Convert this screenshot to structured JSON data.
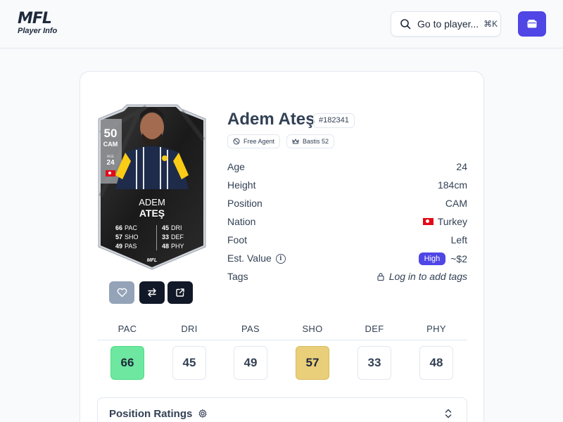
{
  "header": {
    "logo_mark": "MFL",
    "logo_sub": "Player Info",
    "search_label": "Go to player...",
    "search_shortcut": "⌘K"
  },
  "card_graphic": {
    "rating": "50",
    "position": "CAM",
    "age_label": "AGE",
    "age": "24",
    "first_name": "ADEM",
    "last_name": "ATEŞ",
    "stats_left": [
      {
        "value": "66",
        "label": "PAC"
      },
      {
        "value": "57",
        "label": "SHO"
      },
      {
        "value": "49",
        "label": "PAS"
      }
    ],
    "stats_right": [
      {
        "value": "45",
        "label": "DRI"
      },
      {
        "value": "33",
        "label": "DEF"
      },
      {
        "value": "48",
        "label": "PHY"
      }
    ],
    "footer_logo": "MFL"
  },
  "player": {
    "name": "Adem Ateş",
    "id": "#182341",
    "badges": {
      "agent": "Free Agent",
      "club": "Bastis 52"
    }
  },
  "info": {
    "age": {
      "label": "Age",
      "value": "24"
    },
    "height": {
      "label": "Height",
      "value": "184cm"
    },
    "position": {
      "label": "Position",
      "value": "CAM"
    },
    "nation": {
      "label": "Nation",
      "value": "Turkey"
    },
    "foot": {
      "label": "Foot",
      "value": "Left"
    },
    "value": {
      "label": "Est. Value",
      "pill": "High",
      "value": "~$2"
    },
    "tags": {
      "label": "Tags",
      "value": "Log in to add tags"
    }
  },
  "stats": [
    {
      "label": "PAC",
      "value": "66",
      "highlight": "green"
    },
    {
      "label": "DRI",
      "value": "45",
      "highlight": "none"
    },
    {
      "label": "PAS",
      "value": "49",
      "highlight": "none"
    },
    {
      "label": "SHO",
      "value": "57",
      "highlight": "yellow"
    },
    {
      "label": "DEF",
      "value": "33",
      "highlight": "none"
    },
    {
      "label": "PHY",
      "value": "48",
      "highlight": "none"
    }
  ],
  "position_ratings": {
    "title": "Position Ratings"
  },
  "colors": {
    "accent": "#4f46e5",
    "stat_green": "#6ee7a0",
    "stat_yellow": "#e9cf7a",
    "card_dark": "#1f1f1f"
  }
}
